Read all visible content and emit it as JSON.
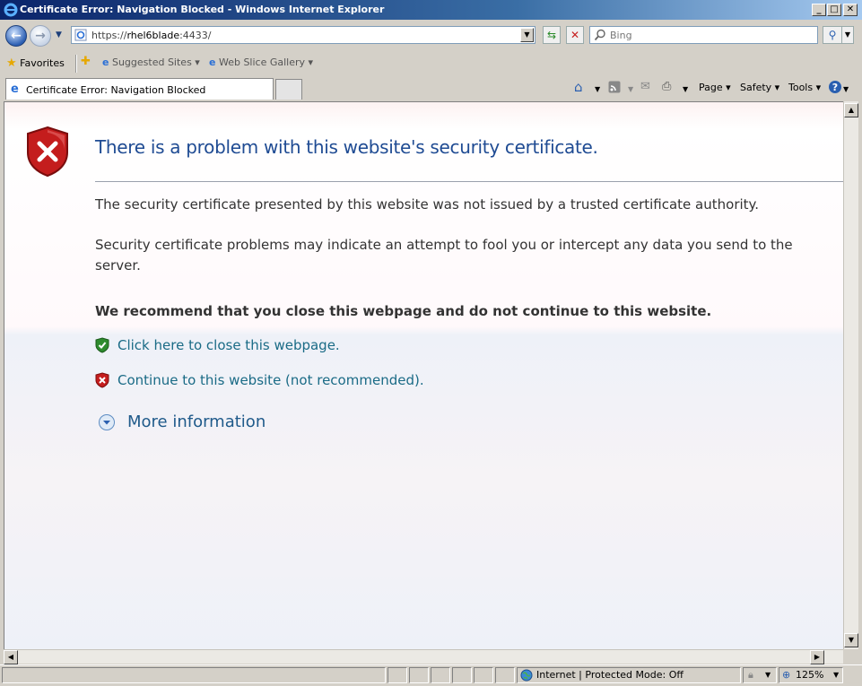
{
  "window": {
    "title": "Certificate Error: Navigation Blocked - Windows Internet Explorer",
    "controls": {
      "minimize": "_",
      "maximize": "□",
      "close": "✕"
    }
  },
  "navbar": {
    "url_prefix": "https://",
    "url_host": "rhel6blade",
    "url_port": ":4433/",
    "search_placeholder": "Bing"
  },
  "favorites_bar": {
    "favorites_label": "Favorites",
    "items": [
      {
        "label": "Suggested Sites ▾"
      },
      {
        "label": "Web Slice Gallery ▾"
      }
    ]
  },
  "tab": {
    "label": "Certificate Error: Navigation Blocked"
  },
  "command_bar": {
    "page": "Page ▾",
    "safety": "Safety ▾",
    "tools": "Tools ▾"
  },
  "content": {
    "headline": "There is a problem with this website's security certificate.",
    "paragraph1": "The security certificate presented by this website was not issued by a trusted certificate authority.",
    "paragraph2": "Security certificate problems may indicate an attempt to fool you or intercept any data you send to the server.",
    "recommend": "We recommend that you close this webpage and do not continue to this website.",
    "close_link": "Click here to close this webpage.",
    "continue_link": "Continue to this website (not recommended).",
    "more_info": "More information"
  },
  "statusbar": {
    "zone": "Internet | Protected Mode: Off",
    "zoom": "125%"
  },
  "colors": {
    "headline": "#1f4b93",
    "link": "#1a6b86",
    "shield_red": "#c41d1d",
    "shield_green": "#2e8b2e"
  }
}
